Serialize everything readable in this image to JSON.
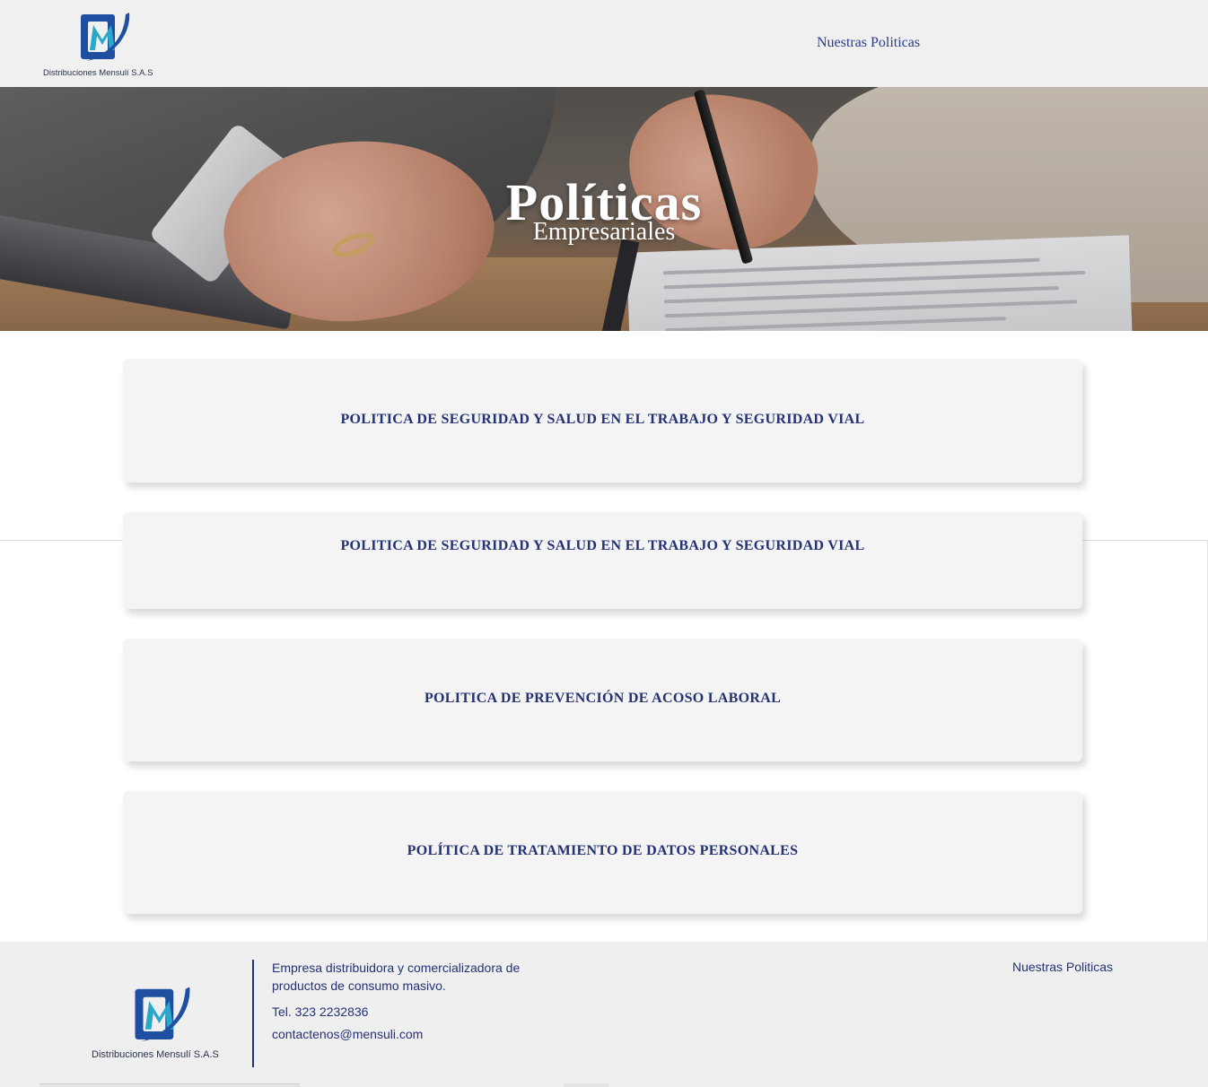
{
  "header": {
    "logo_text": "Distribuciones Mensulí S.A.S",
    "nav_link": "Nuestras Politicas"
  },
  "hero": {
    "title": "Políticas",
    "subtitle": "Empresariales"
  },
  "policies": [
    {
      "label": "POLITICA DE SEGURIDAD Y SALUD EN EL TRABAJO Y SEGURIDAD VIAL"
    },
    {
      "label": "POLITICA DE SEGURIDAD Y SALUD EN EL TRABAJO Y SEGURIDAD VIAL"
    },
    {
      "label": "POLITICA DE PREVENCIÓN DE ACOSO LABORAL"
    },
    {
      "label": "POLÍTICA DE TRATAMIENTO DE DATOS PERSONALES"
    }
  ],
  "footer": {
    "logo_text": "Distribuciones Mensulí S.A.S",
    "description": "Empresa distribuidora y comercializadora de productos de consumo masivo.",
    "description_line1": "Empresa distribuidora y comercializadora de",
    "description_line2": "productos de consumo masivo.",
    "phone": "Tel. 323 2232836",
    "email": "contactenos@mensuli.com",
    "nav_link": "Nuestras Politicas"
  },
  "colors": {
    "brand_navy": "#243172",
    "brand_blue": "#1e5fb4",
    "brand_teal": "#2aa7c9"
  }
}
